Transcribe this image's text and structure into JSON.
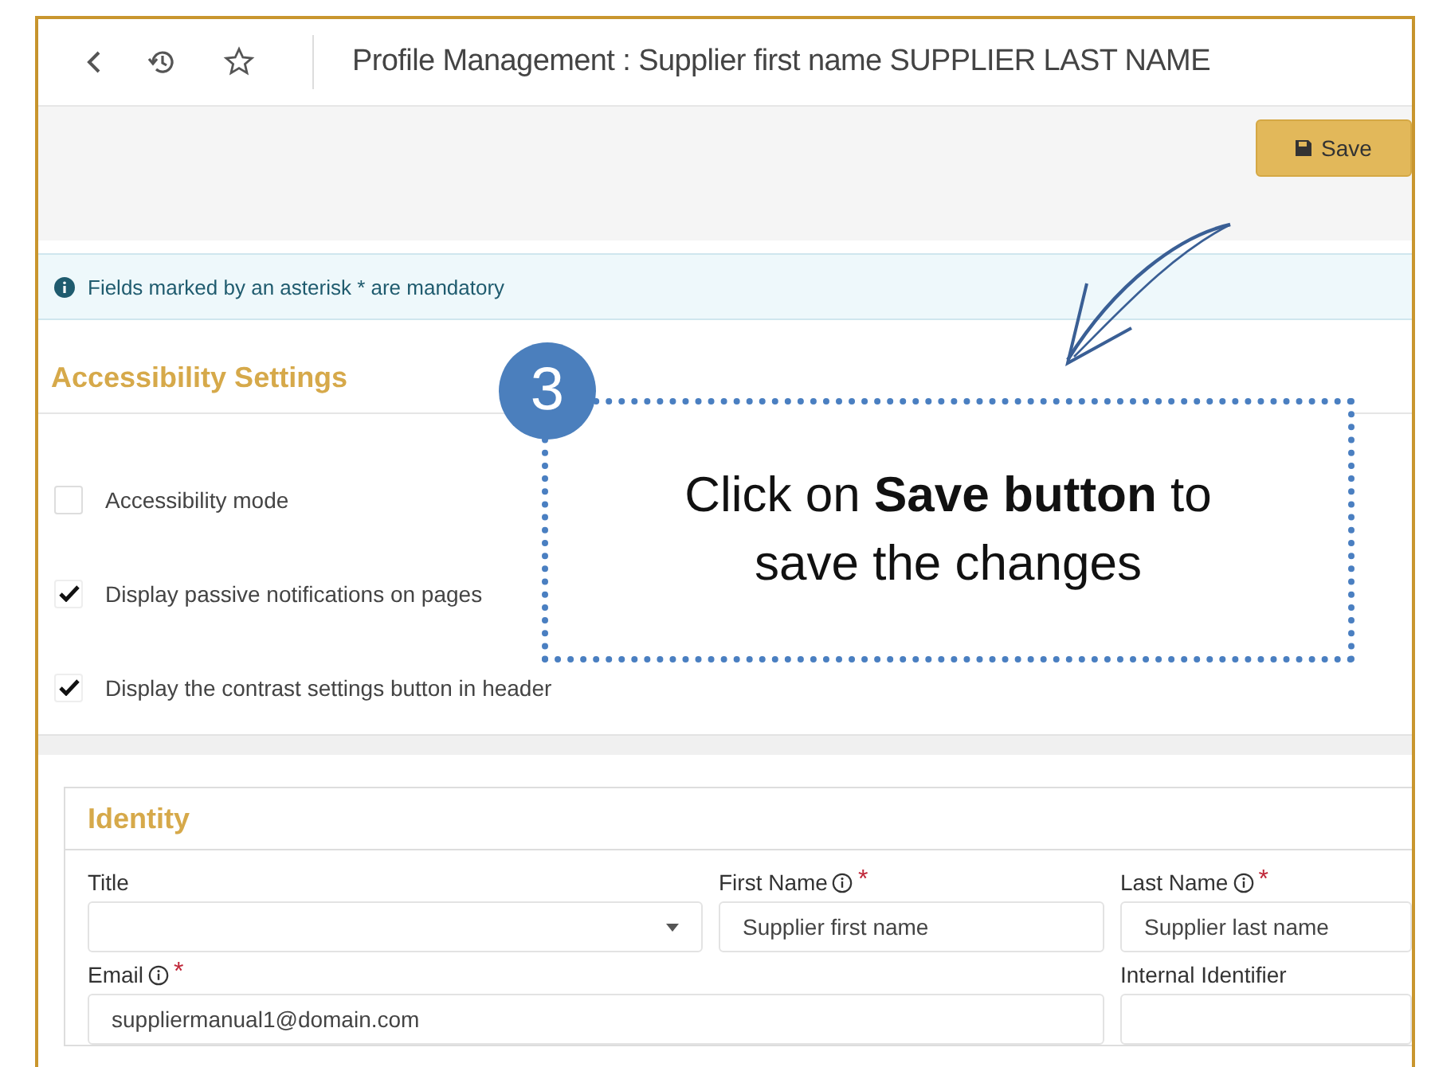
{
  "header": {
    "title": "Profile Management : Supplier first name SUPPLIER LAST NAME"
  },
  "toolbar": {
    "save_label": "Save"
  },
  "info_banner": {
    "text": "Fields marked by an asterisk * are mandatory"
  },
  "accessibility": {
    "heading": "Accessibility Settings",
    "options": [
      {
        "label": "Accessibility mode",
        "checked": false
      },
      {
        "label": "Display passive notifications on pages",
        "checked": true
      },
      {
        "label": "Display the contrast settings button in header",
        "checked": true
      }
    ]
  },
  "identity": {
    "heading": "Identity",
    "fields": [
      {
        "kind": "select",
        "label": "Title",
        "info": false
      },
      {
        "kind": "text",
        "label": "First Name",
        "info": true,
        "required_mark": "*",
        "value": "Supplier first name"
      },
      {
        "kind": "text",
        "label": "Last Name",
        "info": true,
        "required_mark": "*",
        "value": "Supplier last name"
      },
      {
        "kind": "wide",
        "label": "Email",
        "info": true,
        "required_mark": "*",
        "value": "suppliermanual1@domain.com"
      },
      {
        "kind": "text",
        "label": "Internal Identifier",
        "info": false
      }
    ]
  },
  "callout": {
    "step": "3",
    "text": "Click on **Save button** to save the changes"
  }
}
